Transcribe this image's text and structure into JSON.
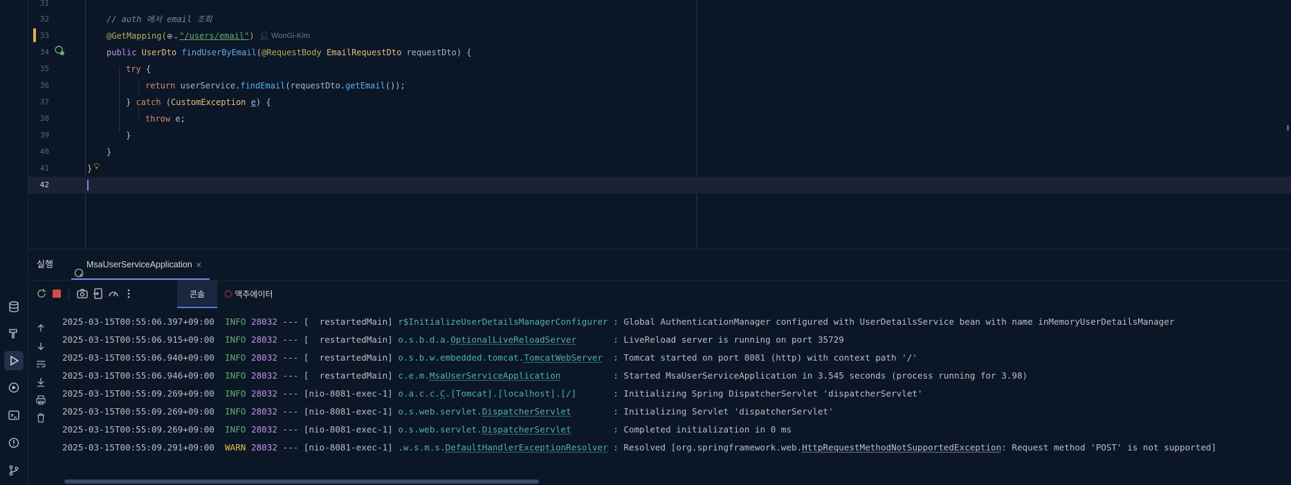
{
  "editor": {
    "lines": [
      {
        "n": "31",
        "code": ""
      },
      {
        "n": "32",
        "code": "// auth 에서 email 조회"
      },
      {
        "n": "33",
        "code": "@GetMapping(\"/users/email\")"
      },
      {
        "n": "34",
        "code": "public UserDto findUserByEmail(@RequestBody EmailRequestDto requestDto) {"
      },
      {
        "n": "35",
        "code": "try {"
      },
      {
        "n": "36",
        "code": "return userService.findEmail(requestDto.getEmail());"
      },
      {
        "n": "37",
        "code": "} catch (CustomException e) {"
      },
      {
        "n": "38",
        "code": "throw e;"
      },
      {
        "n": "39",
        "code": "}"
      },
      {
        "n": "40",
        "code": "}"
      },
      {
        "n": "41",
        "code": "}"
      },
      {
        "n": "42",
        "code": ""
      }
    ],
    "author_hint": "WonGi-Kim",
    "tokens": {
      "comment": "// auth 에서 email 조회",
      "annotation": "@GetMapping(",
      "url": "\"/users/email\"",
      "close_paren": ")",
      "public_kw": "public",
      "ret_type": "UserDto",
      "method": "findUserByEmail",
      "paren_open": "(",
      "request_body": "@RequestBody",
      "param_type": "EmailRequestDto",
      "param_name": "requestDto",
      "sig_end": ") {",
      "try_kw": "try",
      "brace_open": " {",
      "return_kw": "return",
      "service": "userService",
      "dot": ".",
      "find_email": "findEmail",
      "paren": "(",
      "request_dto": "requestDto",
      "get_email": "getEmail",
      "stmt_end": "());",
      "catch_open": "} ",
      "catch_kw": "catch",
      "catch_paren": " (",
      "exception_type": "CustomException",
      "exception_var": "e",
      "catch_end": ") {",
      "throw_kw": "throw",
      "throw_rest": " e;",
      "close_brace": "}"
    }
  },
  "run_panel": {
    "title": "실행",
    "run_config_tab": "MsaUserServiceApplication",
    "close_symbol": "×",
    "subtabs": {
      "console": "콘솔",
      "actuator": "액추에이터"
    },
    "log": [
      {
        "ts": "2025-03-15T00:55:06.397+09:00",
        "level": "INFO",
        "pid": "28032",
        "sep": "---",
        "thread": "[  restartedMain]",
        "logger_prefix": "r$InitializeUserDetailsManagerConfigurer",
        "logger_link": "",
        "pad": " ",
        "msg": ": Global AuthenticationManager configured with UserDetailsService bean with name inMemoryUserDetailsManager"
      },
      {
        "ts": "2025-03-15T00:55:06.915+09:00",
        "level": "INFO",
        "pid": "28032",
        "sep": "---",
        "thread": "[  restartedMain]",
        "logger_prefix": "o.s.b.d.a.",
        "logger_link": "OptionalLiveReloadServer",
        "pad": "       ",
        "msg": ": LiveReload server is running on port 35729"
      },
      {
        "ts": "2025-03-15T00:55:06.940+09:00",
        "level": "INFO",
        "pid": "28032",
        "sep": "---",
        "thread": "[  restartedMain]",
        "logger_prefix": "o.s.b.w.embedded.tomcat.",
        "logger_link": "TomcatWebServer",
        "pad": "  ",
        "msg": ": Tomcat started on port 8081 (http) with context path '/'"
      },
      {
        "ts": "2025-03-15T00:55:06.946+09:00",
        "level": "INFO",
        "pid": "28032",
        "sep": "---",
        "thread": "[  restartedMain]",
        "logger_prefix": "c.e.m.",
        "logger_link": "MsaUserServiceApplication",
        "pad": "          ",
        "msg": ": Started MsaUserServiceApplication in 3.545 seconds (process running for 3.98)"
      },
      {
        "ts": "2025-03-15T00:55:09.269+09:00",
        "level": "INFO",
        "pid": "28032",
        "sep": "---",
        "thread": "[nio-8081-exec-1]",
        "logger_prefix": "o.a.c.c.",
        "logger_link": "C",
        "logger_suffix": ".[Tomcat].[localhost].[/]",
        "pad": "       ",
        "msg": ": Initializing Spring DispatcherServlet 'dispatcherServlet'"
      },
      {
        "ts": "2025-03-15T00:55:09.269+09:00",
        "level": "INFO",
        "pid": "28032",
        "sep": "---",
        "thread": "[nio-8081-exec-1]",
        "logger_prefix": "o.s.web.servlet.",
        "logger_link": "DispatcherServlet",
        "pad": "        ",
        "msg": ": Initializing Servlet 'dispatcherServlet'"
      },
      {
        "ts": "2025-03-15T00:55:09.269+09:00",
        "level": "INFO",
        "pid": "28032",
        "sep": "---",
        "thread": "[nio-8081-exec-1]",
        "logger_prefix": "o.s.web.servlet.",
        "logger_link": "DispatcherServlet",
        "pad": "        ",
        "msg": ": Completed initialization in 0 ms"
      },
      {
        "ts": "2025-03-15T00:55:09.291+09:00",
        "level": "WARN",
        "pid": "28032",
        "sep": "---",
        "thread": "[nio-8081-exec-1]",
        "logger_prefix": ".w.s.m.s.",
        "logger_link": "DefaultHandlerExceptionResolver",
        "pad": " ",
        "msg_prefix": ": Resolved [org.springframework.web.",
        "msg_link": "HttpRequestMethodNotSupportedException",
        "msg_suffix": ": Request method 'POST' is not supported]"
      }
    ]
  },
  "icons": {
    "left_toolbar": [
      "database-icon",
      "hammer-icon",
      "run-icon",
      "services-icon",
      "terminal-icon",
      "problems-icon",
      "git-icon"
    ],
    "panel_toolbar": [
      "rerun-icon",
      "stop-icon",
      "screenshot-icon",
      "exit-icon",
      "dashboard-icon",
      "more-icon"
    ],
    "console_side": [
      "scroll-up-icon",
      "scroll-down-icon",
      "soft-wrap-icon",
      "scroll-to-end-icon",
      "print-icon",
      "clear-icon"
    ]
  },
  "colors": {
    "background": "#0b1626",
    "accent": "#8a7cf0",
    "info": "#6aab73",
    "warn": "#e2c044"
  }
}
